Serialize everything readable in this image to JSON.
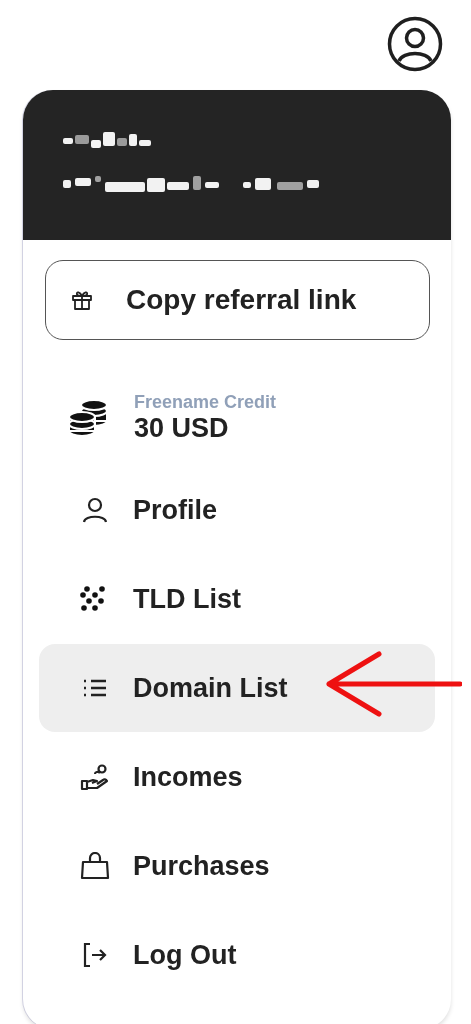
{
  "referral_button": {
    "label": "Copy referral link"
  },
  "credit": {
    "label": "Freename Credit",
    "amount": "30 USD"
  },
  "menu": [
    {
      "label": "Profile",
      "selected": false
    },
    {
      "label": "TLD List",
      "selected": false
    },
    {
      "label": "Domain List",
      "selected": true
    },
    {
      "label": "Incomes",
      "selected": false
    },
    {
      "label": "Purchases",
      "selected": false
    },
    {
      "label": "Log Out",
      "selected": false
    }
  ]
}
